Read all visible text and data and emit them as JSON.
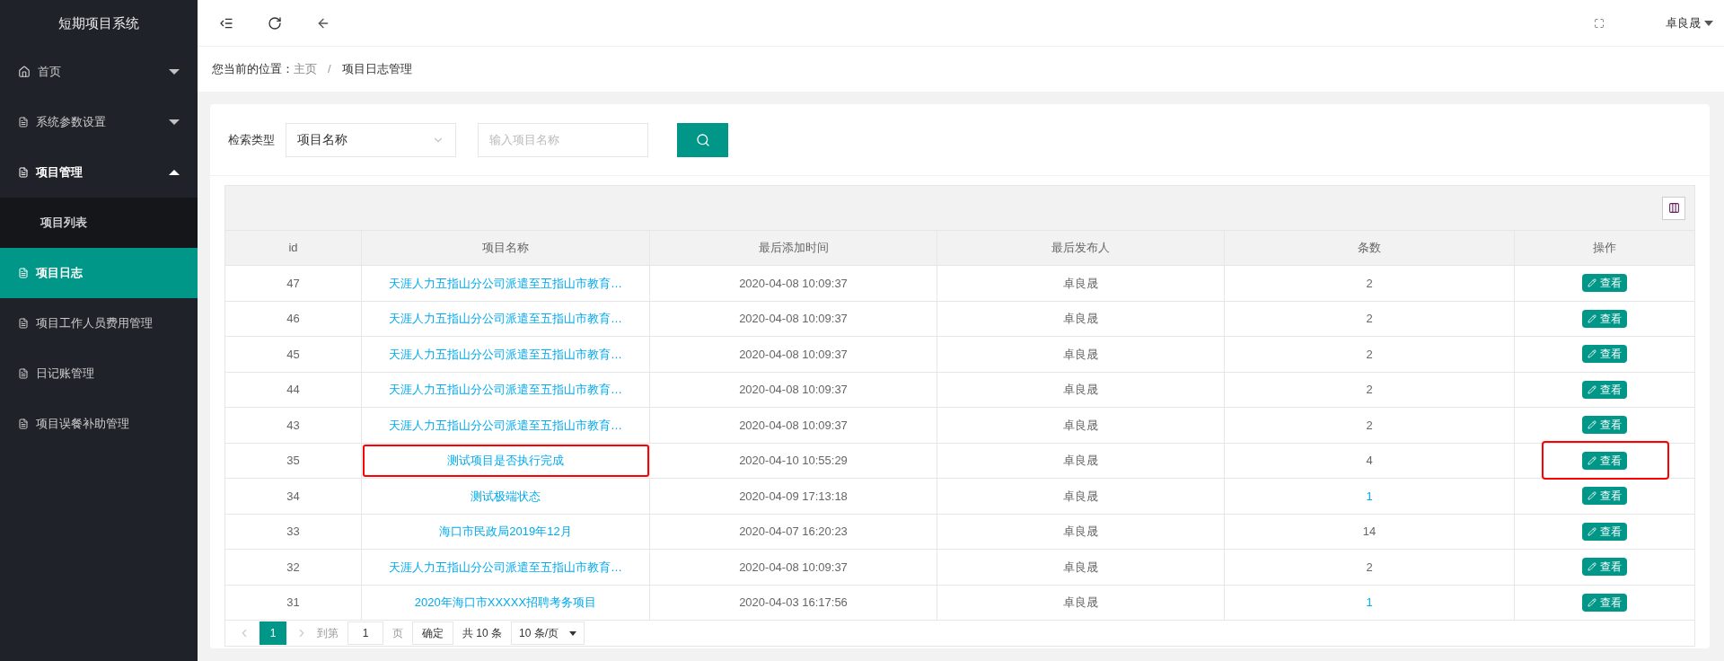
{
  "sidebar": {
    "title": "短期项目系统",
    "items": [
      {
        "label": "首页",
        "kind": "home",
        "expanded": false,
        "selected": false
      },
      {
        "label": "系统参数设置",
        "kind": "page",
        "expanded": false,
        "selected": false
      },
      {
        "label": "项目管理",
        "kind": "page",
        "expanded": true,
        "selected": false,
        "children": [
          {
            "label": "项目列表",
            "selected": false
          }
        ]
      },
      {
        "label": "项目日志",
        "kind": "page",
        "selected": true
      },
      {
        "label": "项目工作人员费用管理",
        "kind": "page",
        "selected": false
      },
      {
        "label": "日记账管理",
        "kind": "page",
        "selected": false
      },
      {
        "label": "项目误餐补助管理",
        "kind": "page",
        "selected": false
      }
    ]
  },
  "topbar": {
    "user": "卓良晟"
  },
  "breadcrumb": {
    "prefix": "您当前的位置：",
    "items": [
      "主页",
      "项目日志管理"
    ],
    "separator": "/"
  },
  "search": {
    "label": "检索类型",
    "type_value": "项目名称",
    "placeholder": "输入项目名称"
  },
  "table": {
    "columns": [
      "id",
      "项目名称",
      "最后添加时间",
      "最后发布人",
      "条数",
      "操作"
    ],
    "rows": [
      {
        "id": "47",
        "name": "天涯人力五指山分公司派遣至五指山市教育…",
        "time": "2020-04-08 10:09:37",
        "publisher": "卓良晟",
        "count": "2",
        "count_link": false,
        "highlighted": false,
        "action": "查看"
      },
      {
        "id": "46",
        "name": "天涯人力五指山分公司派遣至五指山市教育…",
        "time": "2020-04-08 10:09:37",
        "publisher": "卓良晟",
        "count": "2",
        "count_link": false,
        "highlighted": false,
        "action": "查看"
      },
      {
        "id": "45",
        "name": "天涯人力五指山分公司派遣至五指山市教育…",
        "time": "2020-04-08 10:09:37",
        "publisher": "卓良晟",
        "count": "2",
        "count_link": false,
        "highlighted": false,
        "action": "查看"
      },
      {
        "id": "44",
        "name": "天涯人力五指山分公司派遣至五指山市教育…",
        "time": "2020-04-08 10:09:37",
        "publisher": "卓良晟",
        "count": "2",
        "count_link": false,
        "highlighted": false,
        "action": "查看"
      },
      {
        "id": "43",
        "name": "天涯人力五指山分公司派遣至五指山市教育…",
        "time": "2020-04-08 10:09:37",
        "publisher": "卓良晟",
        "count": "2",
        "count_link": false,
        "highlighted": false,
        "action": "查看"
      },
      {
        "id": "35",
        "name": "测试项目是否执行完成",
        "time": "2020-04-10 10:55:29",
        "publisher": "卓良晟",
        "count": "4",
        "count_link": false,
        "highlighted": true,
        "action": "查看"
      },
      {
        "id": "34",
        "name": "测试极端状态",
        "time": "2020-04-09 17:13:18",
        "publisher": "卓良晟",
        "count": "1",
        "count_link": true,
        "highlighted": false,
        "action": "查看"
      },
      {
        "id": "33",
        "name": "海口市民政局2019年12月",
        "time": "2020-04-07 16:20:23",
        "publisher": "卓良晟",
        "count": "14",
        "count_link": false,
        "highlighted": false,
        "action": "查看"
      },
      {
        "id": "32",
        "name": "天涯人力五指山分公司派遣至五指山市教育…",
        "time": "2020-04-08 10:09:37",
        "publisher": "卓良晟",
        "count": "2",
        "count_link": false,
        "highlighted": false,
        "action": "查看"
      },
      {
        "id": "31",
        "name": "2020年海口市XXXXX招聘考务项目",
        "time": "2020-04-03 16:17:56",
        "publisher": "卓良晟",
        "count": "1",
        "count_link": true,
        "highlighted": false,
        "action": "查看"
      }
    ]
  },
  "pagination": {
    "pages": [
      {
        "label": "1",
        "selected": true
      }
    ],
    "goto_label": "到第",
    "goto_value": "1",
    "page_unit": "页",
    "confirm": "确定",
    "total": "共 10 条",
    "per_page": "10 条/页"
  }
}
